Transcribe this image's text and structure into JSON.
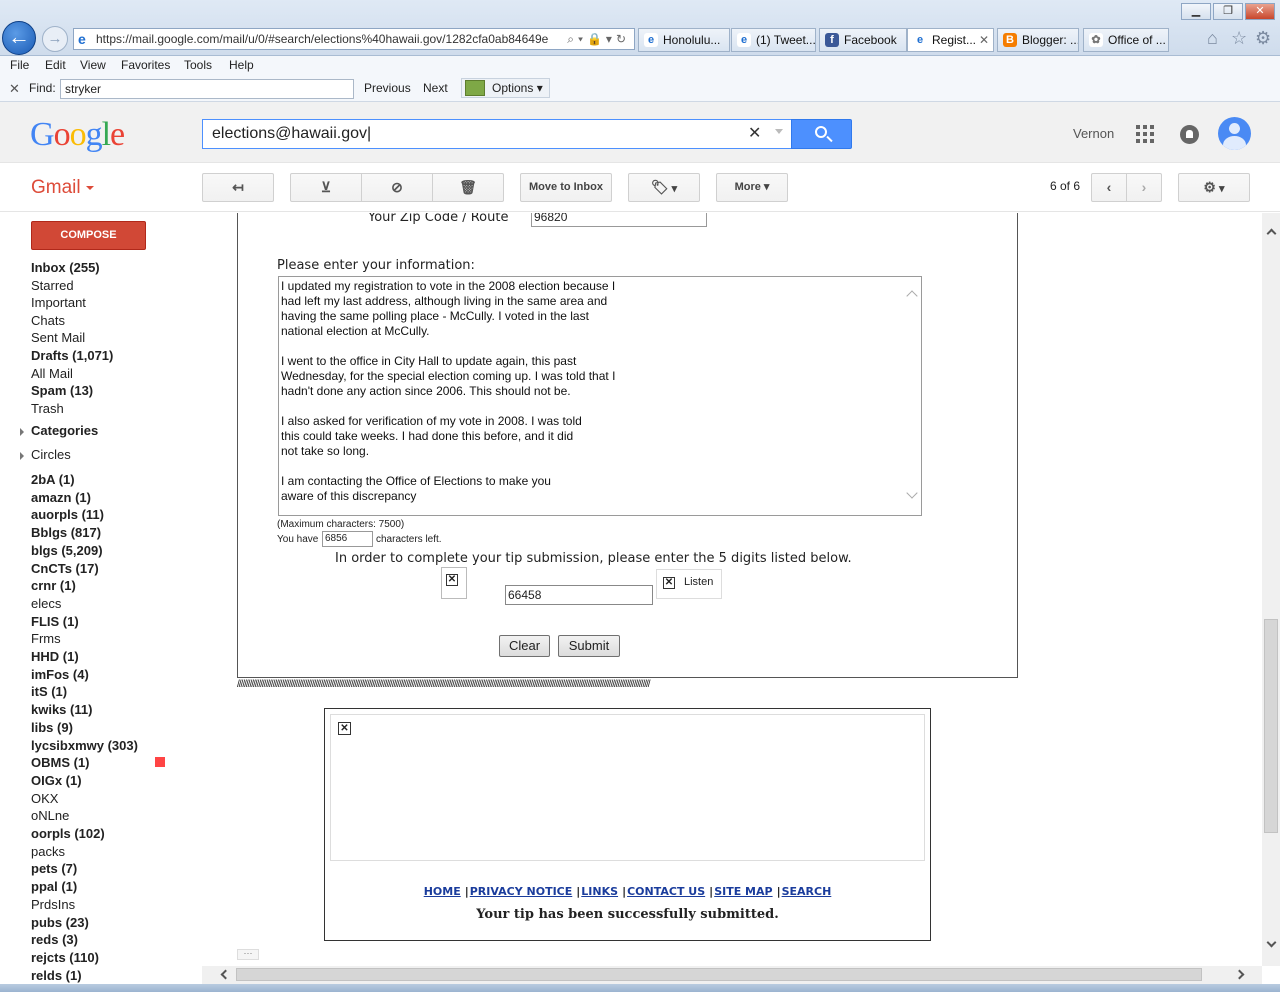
{
  "browser": {
    "url": "https://mail.google.com/mail/u/0/#search/elections%40hawaii.gov/1282cfa0ab84649e",
    "tabs": [
      {
        "label": "Honolulu...",
        "icon": "ie-icon"
      },
      {
        "label": "(1) Tweet...",
        "icon": "ie-icon"
      },
      {
        "label": "Facebook",
        "icon": "facebook-icon"
      },
      {
        "label": "Regist...",
        "icon": "ie-icon",
        "active": true
      },
      {
        "label": "Blogger: ...",
        "icon": "blogger-icon"
      },
      {
        "label": "Office of ...",
        "icon": "flower-icon"
      }
    ],
    "menu": [
      "File",
      "Edit",
      "View",
      "Favorites",
      "Tools",
      "Help"
    ],
    "find": {
      "label": "Find:",
      "value": "stryker",
      "previous": "Previous",
      "next": "Next",
      "options": "Options"
    }
  },
  "gmail": {
    "logo": "Google",
    "search_value": "elections@hawaii.gov",
    "user": "Vernon",
    "app_label": "Gmail",
    "toolbar": {
      "move_to_inbox": "Move to Inbox",
      "more": "More",
      "page_count": "6 of 6"
    },
    "compose": "COMPOSE",
    "nav": [
      {
        "label": "Inbox (255)",
        "bold": true
      },
      {
        "label": "Starred",
        "bold": false
      },
      {
        "label": "Important",
        "bold": false
      },
      {
        "label": "Chats",
        "bold": false
      },
      {
        "label": "Sent Mail",
        "bold": false
      },
      {
        "label": "Drafts (1,071)",
        "bold": true
      },
      {
        "label": "All Mail",
        "bold": false
      },
      {
        "label": "Spam (13)",
        "bold": true
      },
      {
        "label": "Trash",
        "bold": false
      }
    ],
    "categories": "Categories",
    "circles": "Circles",
    "labels": [
      {
        "label": "2bA (1)",
        "bold": true
      },
      {
        "label": "amazn (1)",
        "bold": true
      },
      {
        "label": "auorpls (11)",
        "bold": true
      },
      {
        "label": "Bblgs (817)",
        "bold": true
      },
      {
        "label": "blgs (5,209)",
        "bold": true
      },
      {
        "label": "CnCTs (17)",
        "bold": true
      },
      {
        "label": "crnr (1)",
        "bold": true
      },
      {
        "label": "elecs",
        "bold": false
      },
      {
        "label": "FLIS (1)",
        "bold": true
      },
      {
        "label": "Frms",
        "bold": false
      },
      {
        "label": "HHD (1)",
        "bold": true
      },
      {
        "label": "imFos (4)",
        "bold": true
      },
      {
        "label": "itS (1)",
        "bold": true
      },
      {
        "label": "kwiks (11)",
        "bold": true
      },
      {
        "label": "libs (9)",
        "bold": true
      },
      {
        "label": "lycsibxmwy (303)",
        "bold": true
      },
      {
        "label": "OBMS (1)",
        "bold": true
      },
      {
        "label": "OIGx (1)",
        "bold": true
      },
      {
        "label": "OKX",
        "bold": false
      },
      {
        "label": "oNLne",
        "bold": false
      },
      {
        "label": "oorpls (102)",
        "bold": true
      },
      {
        "label": "packs",
        "bold": false
      },
      {
        "label": "pets (7)",
        "bold": true
      },
      {
        "label": "ppal (1)",
        "bold": true
      },
      {
        "label": "PrdsIns",
        "bold": false
      },
      {
        "label": "pubs (23)",
        "bold": true
      },
      {
        "label": "reds (3)",
        "bold": true
      },
      {
        "label": "rejcts (110)",
        "bold": true
      },
      {
        "label": "relds (1)",
        "bold": true
      }
    ],
    "label_colors": {
      "OBMS": "#ff4444"
    }
  },
  "form": {
    "zip_label": "Your Zip Code / Route",
    "zip_value": "96820",
    "info_label": "Please enter your information:",
    "info_lines": [
      "I updated my registration to vote in the 2008 election because I",
      "had left my last address, although living in the same area and",
      "having the same polling place - McCully. I voted in the last",
      "national election at McCully.",
      "",
      "I went to the office in City Hall to update again, this past",
      "Wednesday, for the special election coming up. I was told that I",
      "hadn't done any action since 2006. This should not be.",
      "",
      "I also asked for verification of my vote in 2008. I was told",
      "this could take weeks. I had done this before, and it did",
      "not take so long.",
      "",
      "I am contacting the Office of Elections to make you",
      "aware of this discrepancy"
    ],
    "max_chars": "(Maximum characters: 7500)",
    "you_have": "You have",
    "chars_left_value": "6856",
    "chars_left_label": "characters left.",
    "tip_instruction": "In order to complete your tip submission, please enter the 5 digits listed below.",
    "captcha_value": "66458",
    "listen": "Listen",
    "clear": "Clear",
    "submit": "Submit",
    "divider": "////////////////////////////////////////////////////////////////////////////////////////////////////////////////////////////////////////////////////////////////////////////////////////////////////////////////////////////////////////"
  },
  "footer": {
    "links": [
      "HOME",
      "PRIVACY NOTICE",
      "LINKS",
      "CONTACT US",
      "SITE MAP",
      "SEARCH"
    ],
    "message": "Your tip has been successfully submitted."
  }
}
